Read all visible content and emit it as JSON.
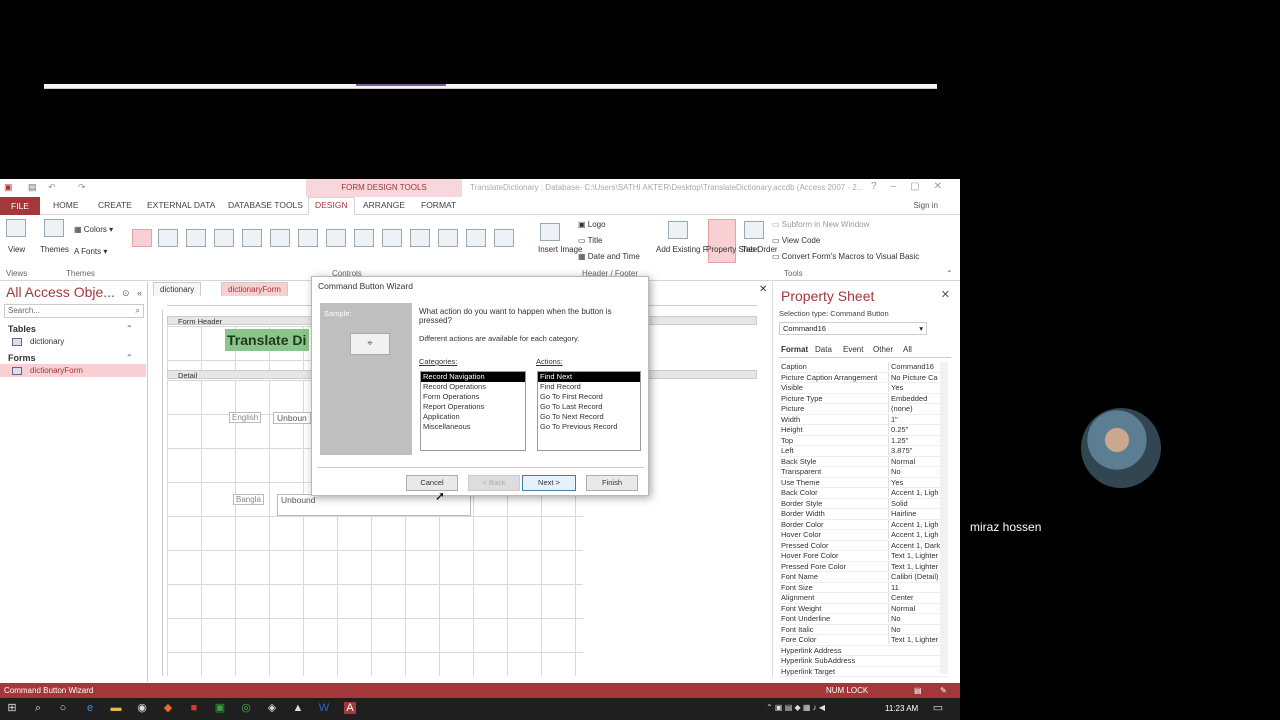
{
  "window": {
    "contextual_tools": "FORM DESIGN TOOLS",
    "title": "TranslateDictionary : Database- C:\\Users\\SATHI AKTER\\Desktop\\TranslateDictionary.accdb (Access 2007 - 2..."
  },
  "ribbon_tabs": [
    "FILE",
    "HOME",
    "CREATE",
    "EXTERNAL DATA",
    "DATABASE TOOLS",
    "DESIGN",
    "ARRANGE",
    "FORMAT"
  ],
  "signin": "Sign in",
  "ribbon": {
    "view": "View",
    "themes": "Themes",
    "colors": "Colors",
    "fonts": "Fonts",
    "group_views": "Views",
    "group_themes": "Themes",
    "group_controls": "Controls",
    "logo": "Logo",
    "title": "Title",
    "date_time": "Date and Time",
    "insert_image": "Insert Image",
    "group_header_footer": "Header / Footer",
    "add_fields": "Add Existing Fields",
    "property_sheet": "Property Sheet",
    "tab_order": "Tab Order",
    "subform_new_window": "Subform in New Window",
    "view_code": "View Code",
    "convert_macros": "Convert Form's Macros to Visual Basic",
    "group_tools": "Tools"
  },
  "nav": {
    "title": "All Access Obje...",
    "search": "Search...",
    "sections": [
      {
        "label": "Tables",
        "items": [
          "dictionary"
        ]
      },
      {
        "label": "Forms",
        "items": [
          "dictionaryForm"
        ]
      }
    ]
  },
  "doc_tabs": [
    "dictionary",
    "dictionaryForm"
  ],
  "form": {
    "header_label": "Form Header",
    "detail_label": "Detail",
    "title": "Translate Di",
    "label_english": "English",
    "unbound1": "Unboun",
    "label_bangla": "Bangla",
    "unbound2": "Unbound"
  },
  "dialog": {
    "title": "Command Button Wizard",
    "sample": "Sample:",
    "question": "What action do you want to happen when the button is pressed?",
    "subtitle": "Different actions are available for each category.",
    "categories_label": "Categories:",
    "actions_label": "Actions:",
    "categories": [
      "Record Navigation",
      "Record Operations",
      "Form Operations",
      "Report Operations",
      "Application",
      "Miscellaneous"
    ],
    "actions": [
      "Find Next",
      "Find Record",
      "Go To First Record",
      "Go To Last Record",
      "Go To Next Record",
      "Go To Previous Record"
    ],
    "btn_cancel": "Cancel",
    "btn_back": "< Back",
    "btn_next": "Next >",
    "btn_finish": "Finish"
  },
  "property_sheet": {
    "title": "Property Sheet",
    "selection_type": "Selection type:  Command Button",
    "selected": "Command16",
    "tabs": [
      "Format",
      "Data",
      "Event",
      "Other",
      "All"
    ],
    "rows": [
      [
        "Caption",
        "Command16"
      ],
      [
        "Picture Caption Arrangement",
        "No Picture Ca"
      ],
      [
        "Visible",
        "Yes"
      ],
      [
        "Picture Type",
        "Embedded"
      ],
      [
        "Picture",
        "(none)"
      ],
      [
        "Width",
        "1\""
      ],
      [
        "Height",
        "0.25\""
      ],
      [
        "Top",
        "1.25\""
      ],
      [
        "Left",
        "3.875\""
      ],
      [
        "Back Style",
        "Normal"
      ],
      [
        "Transparent",
        "No"
      ],
      [
        "Use Theme",
        "Yes"
      ],
      [
        "Back Color",
        "Accent 1, Ligh"
      ],
      [
        "Border Style",
        "Solid"
      ],
      [
        "Border Width",
        "Hairline"
      ],
      [
        "Border Color",
        "Accent 1, Ligh"
      ],
      [
        "Hover Color",
        "Accent 1, Ligh"
      ],
      [
        "Pressed Color",
        "Accent 1, Dark"
      ],
      [
        "Hover Fore Color",
        "Text 1, Lighter"
      ],
      [
        "Pressed Fore Color",
        "Text 1, Lighter"
      ],
      [
        "Font Name",
        "Calibri (Detail)"
      ],
      [
        "Font Size",
        "11"
      ],
      [
        "Alignment",
        "Center"
      ],
      [
        "Font Weight",
        "Normal"
      ],
      [
        "Font Underline",
        "No"
      ],
      [
        "Font Italic",
        "No"
      ],
      [
        "Fore Color",
        "Text 1, Lighter"
      ],
      [
        "Hyperlink Address",
        ""
      ],
      [
        "Hyperlink SubAddress",
        ""
      ],
      [
        "Hyperlink Target",
        ""
      ]
    ]
  },
  "status": {
    "left": "Command Button Wizard",
    "numlock": "NUM LOCK"
  },
  "clock": "11:23 AM",
  "participant": "miraz hossen",
  "colors": {
    "access_red": "#a4373a",
    "selection_pink": "#f8d0d4",
    "header_green": "#8bc58b"
  }
}
